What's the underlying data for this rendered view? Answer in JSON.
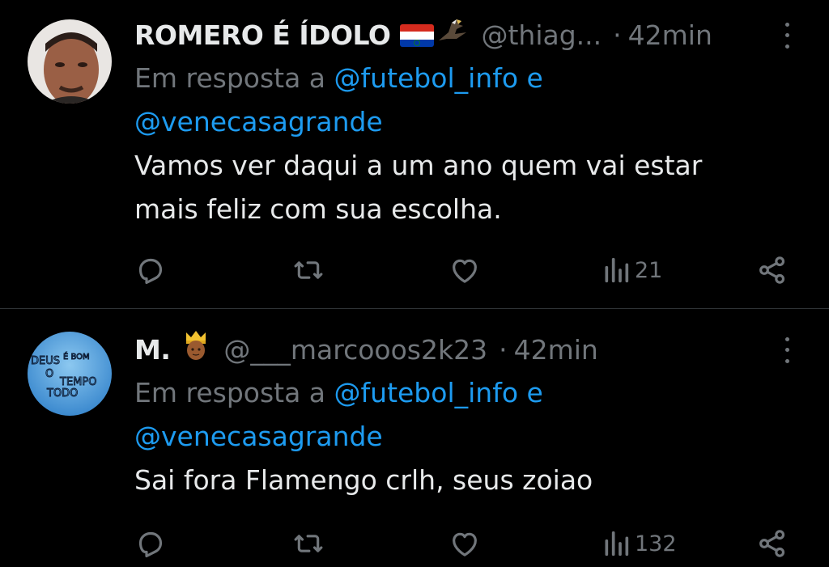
{
  "tweets": [
    {
      "display_name": "ROMERO É ÍDOLO",
      "handle": "@thiag...",
      "separator": "·",
      "time": "42min",
      "reply_prefix": "Em resposta a",
      "mention_1": "@futebol_info",
      "conjunction": "e",
      "mention_2": "@venecasagrande",
      "text_line_1": "Vamos ver daqui a um ano quem vai estar",
      "text_line_2": "mais feliz com sua escolha.",
      "views": "21"
    },
    {
      "display_name": "M.",
      "handle": "@___marcooos2k23",
      "separator": "·",
      "time": "42min",
      "reply_prefix": "Em resposta a",
      "mention_1": "@futebol_info",
      "conjunction": "e",
      "mention_2": "@venecasagrande",
      "text_line_1": "Sai fora Flamengo crlh, seus zoiao",
      "views": "132",
      "avatar_text": [
        "DEUS",
        "É BOM",
        "O",
        "TEMPO",
        "TODO"
      ]
    }
  ],
  "icons": {
    "reply": "reply-icon",
    "retweet": "retweet-icon",
    "like": "like-icon",
    "views": "views-icon",
    "share": "share-icon",
    "more": "more-icon"
  },
  "colors": {
    "background": "#000000",
    "text": "#e7e9ea",
    "secondary": "#71767b",
    "link": "#1d9bf0",
    "divider": "#2f3336"
  }
}
